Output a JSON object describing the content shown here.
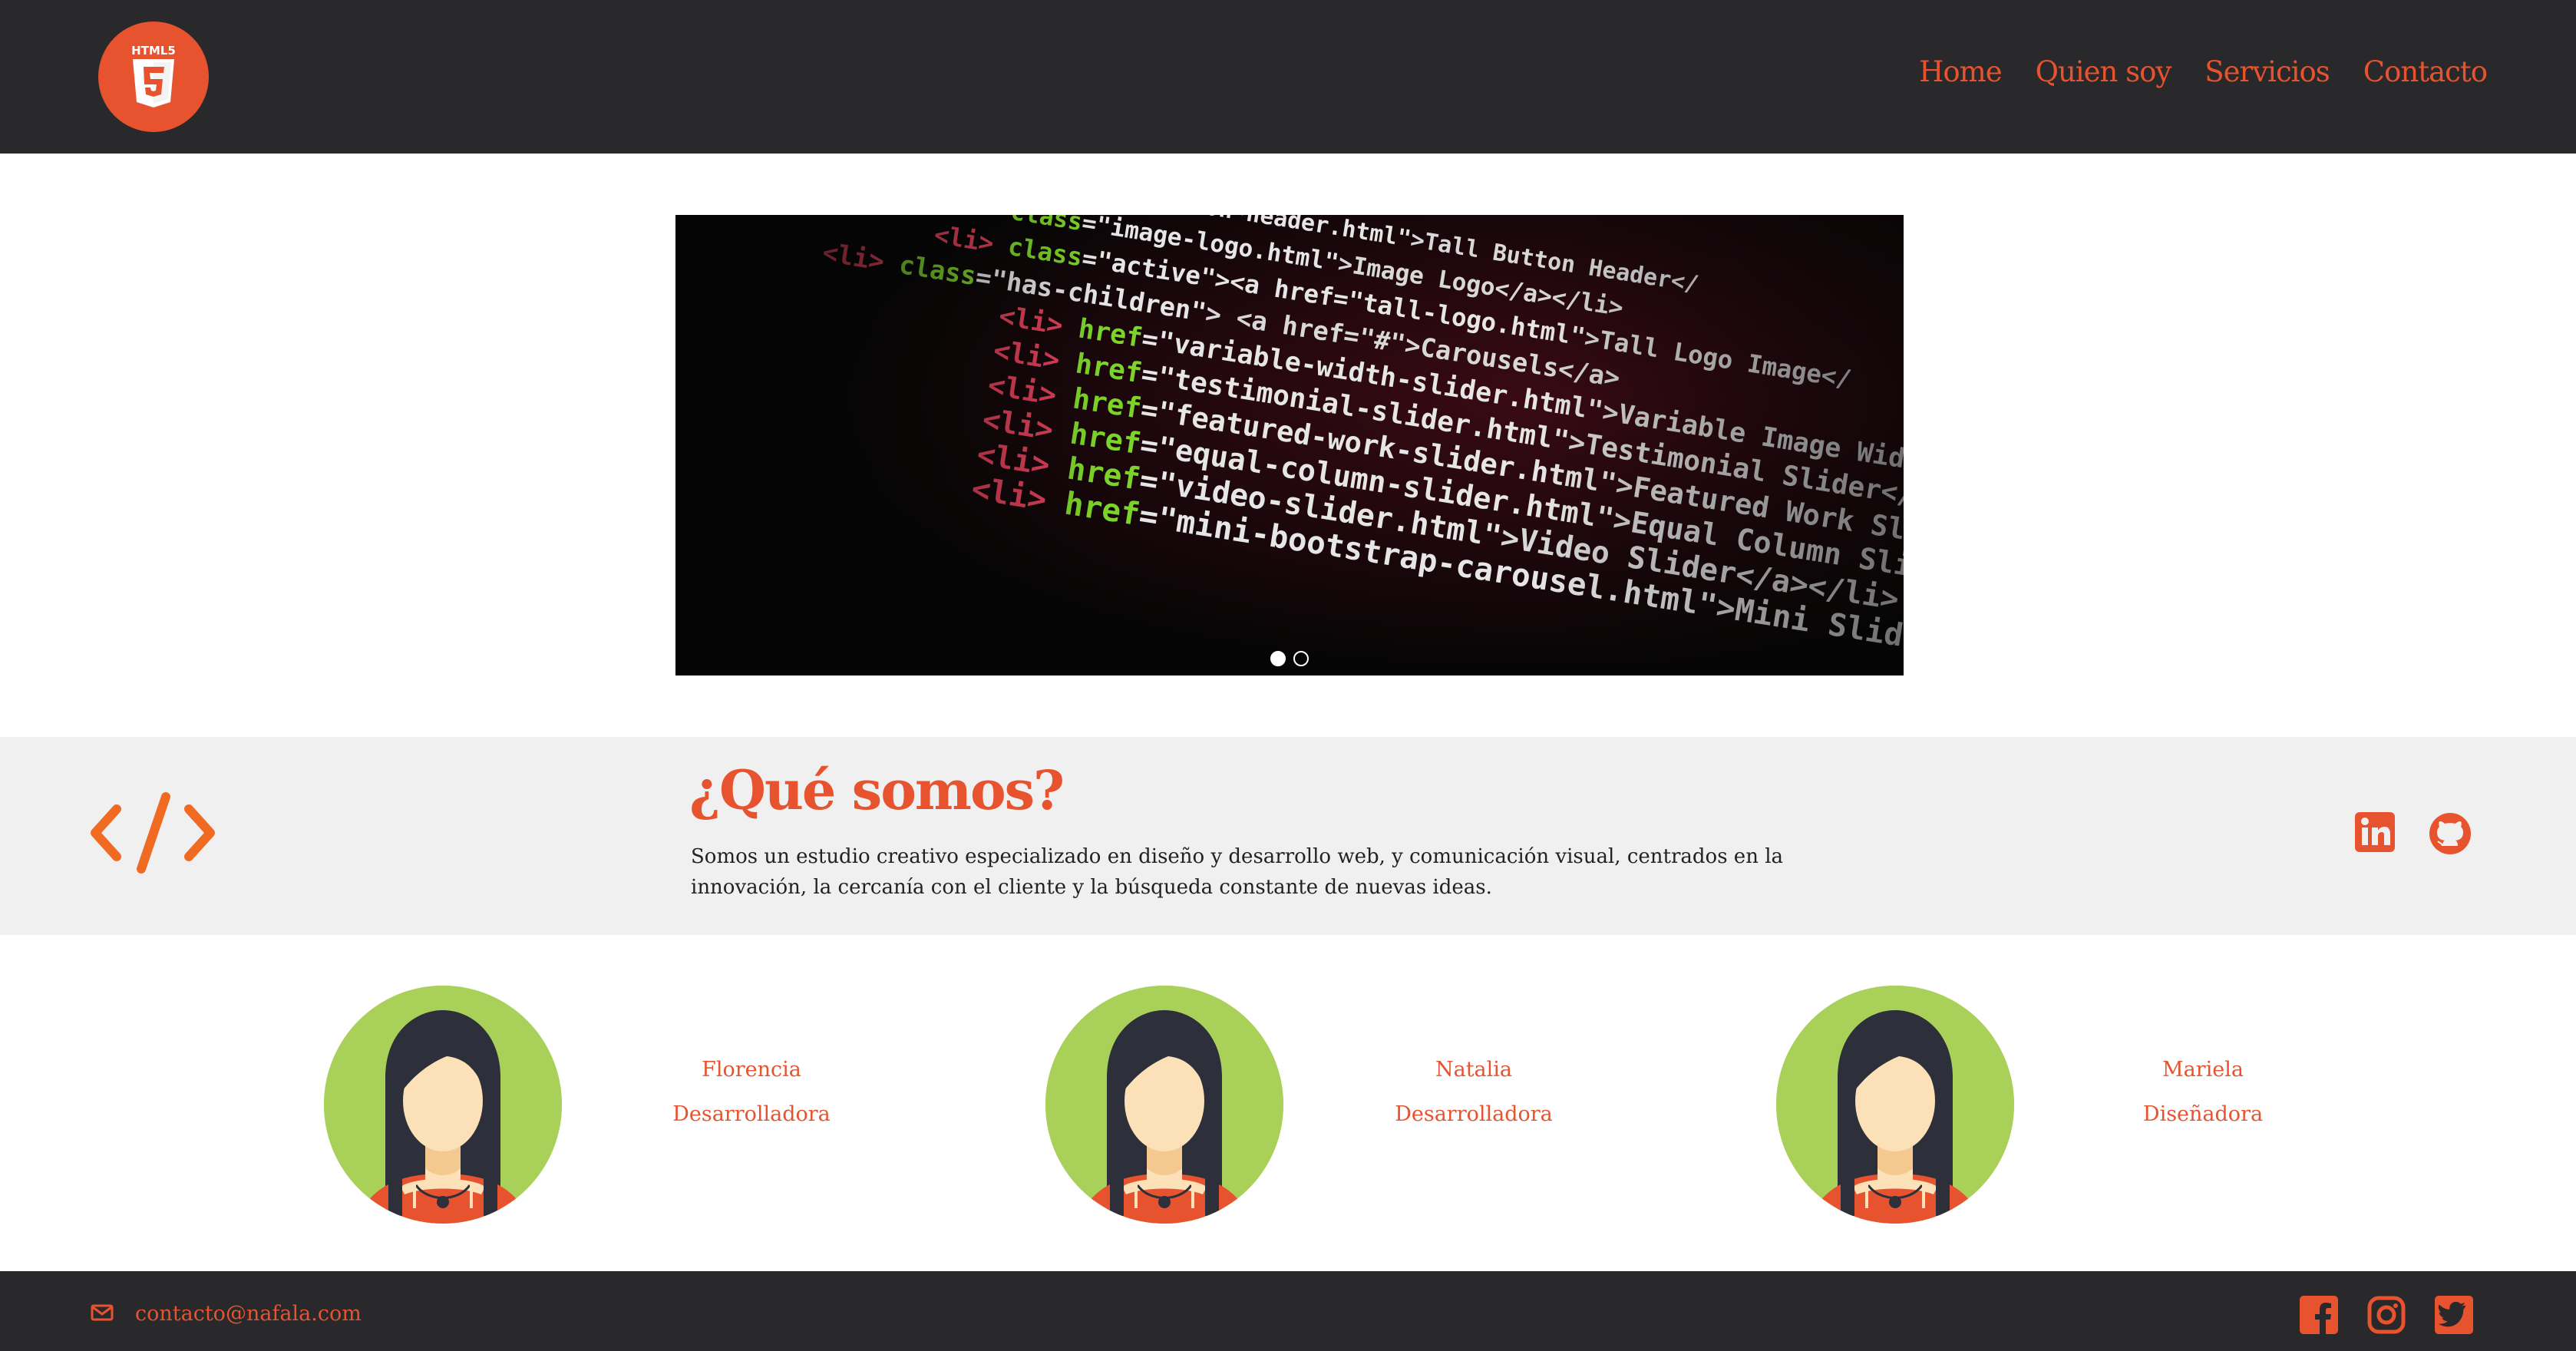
{
  "header": {
    "logo_alt": "HTML5",
    "nav": [
      {
        "label": "Home"
      },
      {
        "label": "Quien soy"
      },
      {
        "label": "Servicios"
      },
      {
        "label": "Contacto"
      }
    ]
  },
  "carousel": {
    "slides": 2,
    "active_slide": 1,
    "code_lines": [
      {
        "tag": "a",
        "attr": "href",
        "value": "\"tall-button-header.html\"",
        "text": ">Tall Button Header</"
      },
      {
        "tag": "li",
        "attr": "class",
        "value": "\"image-logo.html\"",
        "text": ">Image Logo</a></li>"
      },
      {
        "tag": "li",
        "attr": "class",
        "value": "\"active\"><a href=\"tall-logo.html\"",
        "text": ">Tall Logo Image</"
      },
      {
        "tag": "li",
        "attr": "class",
        "value": "\"has-children\"",
        "text": "> <a href=\"#\">Carousels</a>"
      },
      {
        "tag": "li",
        "attr": "href",
        "value": "\"variable-width-slider.html\"",
        "text": ">Variable Image Width"
      },
      {
        "tag": "li",
        "attr": "href",
        "value": "\"testimonial-slider.html\"",
        "text": ">Testimonial Slider</"
      },
      {
        "tag": "li",
        "attr": "href",
        "value": "\"featured-work-slider.html\"",
        "text": ">Featured Work Slider"
      },
      {
        "tag": "li",
        "attr": "href",
        "value": "\"equal-column-slider.html\"",
        "text": ">Equal Column Slider"
      },
      {
        "tag": "li",
        "attr": "href",
        "value": "\"video-slider.html\"",
        "text": ">Video Slider</a></li>"
      },
      {
        "tag": "li",
        "attr": "href",
        "value": "\"mini-bootstrap-carousel.html\"",
        "text": ">Mini Slider</a>"
      }
    ]
  },
  "about": {
    "title": "¿Qué somos?",
    "text": "Somos un estudio creativo especializado en diseño y desarrollo web, y comunicación visual, centrados en la innovación, la cercanía con el cliente y la búsqueda constante de nuevas ideas."
  },
  "team": [
    {
      "name": "Florencia",
      "role": "Desarrolladora"
    },
    {
      "name": "Natalia",
      "role": "Desarrolladora"
    },
    {
      "name": "Mariela",
      "role": "Diseñadora"
    }
  ],
  "footer": {
    "email": "contacto@nafala.com"
  },
  "colors": {
    "accent": "#e8532f",
    "header_bg": "#29292b",
    "about_bg": "#f0f0f0",
    "avatar_bg": "#a9d15a"
  },
  "icons": {
    "logo": "html5-icon",
    "about": "code-icon",
    "social_top": [
      "linkedin-icon",
      "github-icon"
    ],
    "email": "envelope-icon",
    "social_bottom": [
      "facebook-icon",
      "instagram-icon",
      "twitter-icon"
    ]
  }
}
